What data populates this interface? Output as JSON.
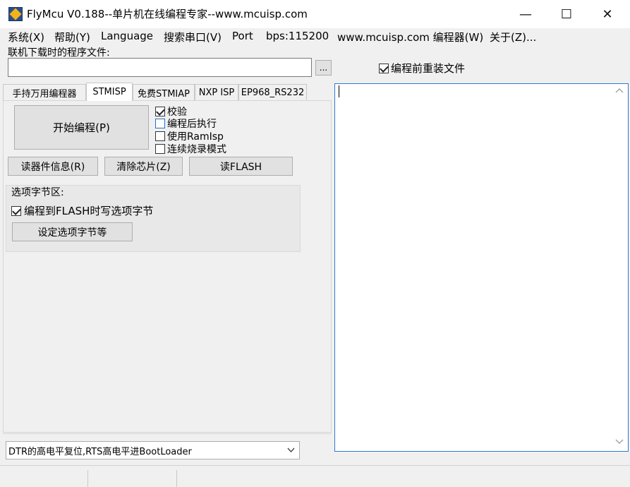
{
  "window": {
    "title": "FlyMcu V0.188--单片机在线编程专家--www.mcuisp.com",
    "minimize_glyph": "—",
    "maximize_glyph": "☐",
    "close_glyph": "✕"
  },
  "menu": [
    "系统(X)",
    "帮助(Y)",
    "Language",
    "搜索串口(V)",
    "Port",
    "bps:115200",
    "www.mcuisp.com 编程器(W)",
    "关于(Z)..."
  ],
  "file": {
    "label": "联机下载时的程序文件:",
    "value": "",
    "browse_label": "...",
    "reload_label": "编程前重装文件",
    "reload_checked": true
  },
  "tabs": [
    "手持万用编程器",
    "STMISP",
    "免费STMIAP",
    "NXP ISP",
    "EP968_RS232"
  ],
  "active_tab": "STMISP",
  "stmisp": {
    "program_button": "开始编程(P)",
    "options": [
      {
        "label": "校验",
        "checked": true
      },
      {
        "label": "编程后执行",
        "checked": false
      },
      {
        "label": "使用RamIsp",
        "checked": false
      },
      {
        "label": "连续烧录模式",
        "checked": false
      }
    ],
    "read_info_button": "读器件信息(R)",
    "erase_button": "清除芯片(Z)",
    "read_flash_button": "读FLASH",
    "option_group": {
      "title": "选项字节区:",
      "write_option_label": "编程到FLASH时写选项字节",
      "write_option_checked": true,
      "set_button": "设定选项字节等"
    }
  },
  "reset_mode": {
    "selected": "DTR的高电平复位,RTS高电平进BootLoader"
  },
  "output": {
    "text": ""
  }
}
